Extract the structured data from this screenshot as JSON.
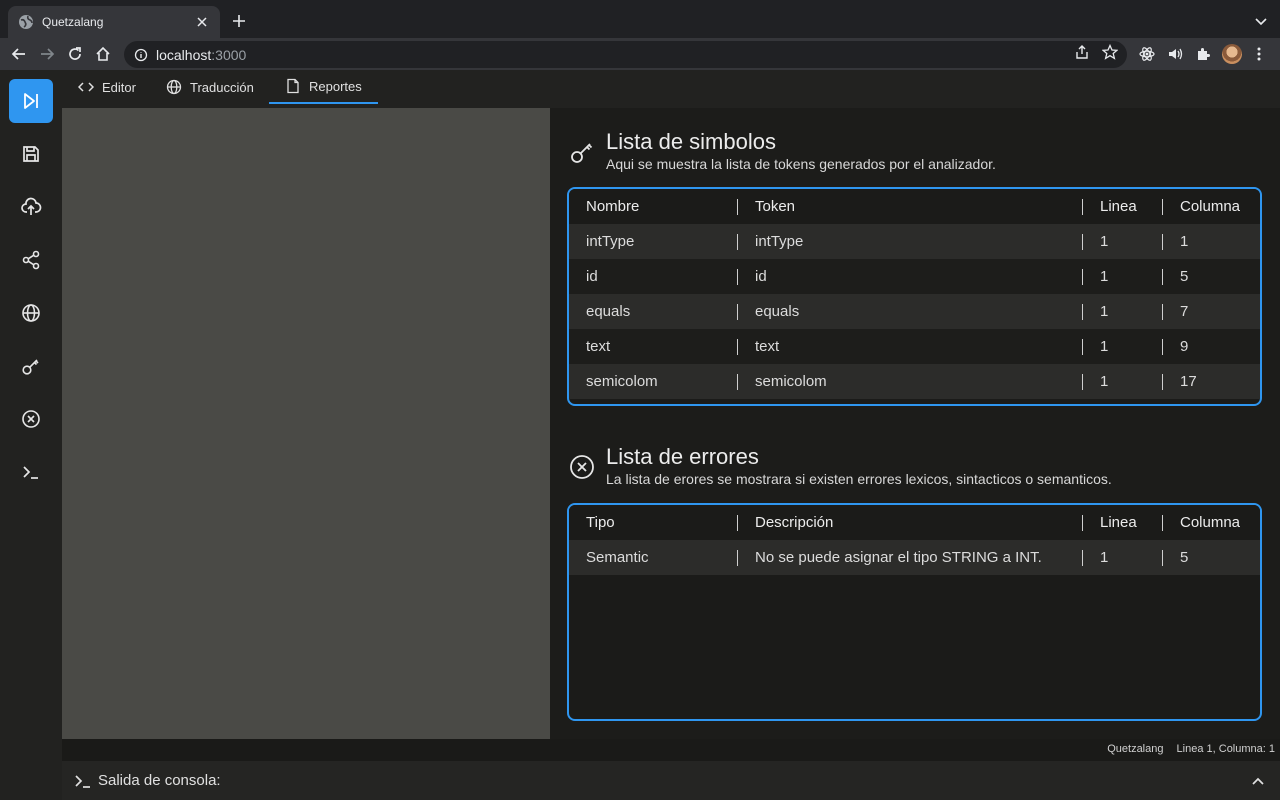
{
  "browser": {
    "tab_title": "Quetzalang",
    "url_host": "localhost",
    "url_port": ":3000"
  },
  "app": {
    "tabs": [
      {
        "label": "Editor",
        "icon": "code-icon"
      },
      {
        "label": "Traducción",
        "icon": "globe-icon"
      },
      {
        "label": "Reportes",
        "icon": "document-icon",
        "active": true
      }
    ],
    "accent": "#2f96f0"
  },
  "symbols": {
    "title": "Lista de simbolos",
    "subtitle": "Aqui se muestra la lista de tokens generados por el analizador.",
    "columns": [
      "Nombre",
      "Token",
      "Linea",
      "Columna"
    ],
    "rows": [
      [
        "intType",
        "intType",
        "1",
        "1"
      ],
      [
        "id",
        "id",
        "1",
        "5"
      ],
      [
        "equals",
        "equals",
        "1",
        "7"
      ],
      [
        "text",
        "text",
        "1",
        "9"
      ],
      [
        "semicolom",
        "semicolom",
        "1",
        "17"
      ]
    ]
  },
  "errors": {
    "title": "Lista de errores",
    "subtitle": "La lista de erores se mostrara si existen errores lexicos, sintacticos o semanticos.",
    "columns": [
      "Tipo",
      "Descripción",
      "Linea",
      "Columna"
    ],
    "rows": [
      [
        "Semantic",
        "No se puede asignar el tipo STRING a INT.",
        "1",
        "5"
      ]
    ]
  },
  "status": {
    "app_name": "Quetzalang",
    "position": "Linea 1, Columna: 1"
  },
  "console": {
    "label": "Salida de consola:"
  }
}
